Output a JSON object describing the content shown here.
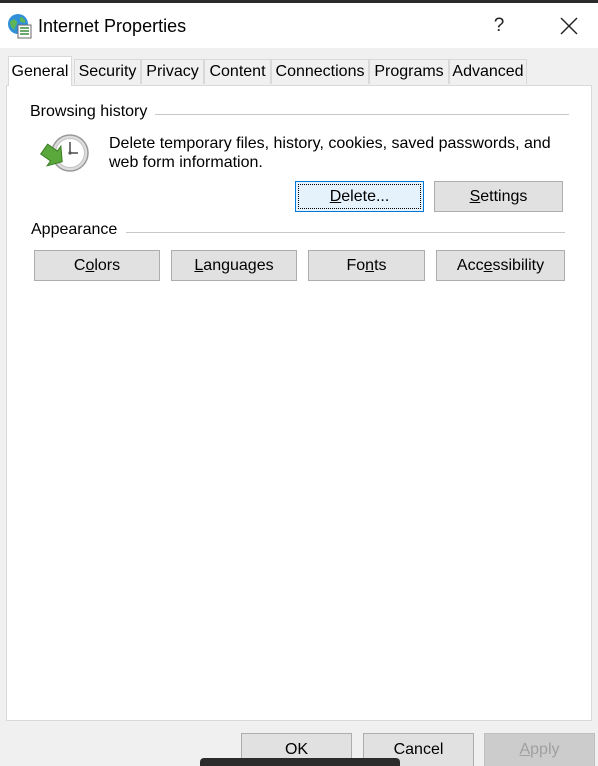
{
  "window": {
    "title": "Internet Properties",
    "app_icon": "internet-options-globe-icon",
    "help_label": "?",
    "close_icon": "close-icon"
  },
  "tabs": [
    {
      "label": "General",
      "active": true
    },
    {
      "label": "Security"
    },
    {
      "label": "Privacy"
    },
    {
      "label": "Content"
    },
    {
      "label": "Connections"
    },
    {
      "label": "Programs"
    },
    {
      "label": "Advanced"
    }
  ],
  "browsing_history": {
    "heading": "Browsing history",
    "icon": "clock-delete-icon",
    "description": "Delete temporary files, history, cookies, saved passwords, and web form information.",
    "delete_btn": {
      "before": "",
      "mnemonic": "D",
      "after": "elete..."
    },
    "settings_btn": {
      "before": "",
      "mnemonic": "S",
      "after": "ettings"
    }
  },
  "appearance": {
    "heading": "Appearance",
    "colors_btn": {
      "before": "C",
      "mnemonic": "o",
      "after": "lors"
    },
    "languages_btn": {
      "before": "",
      "mnemonic": "L",
      "after": "anguages"
    },
    "fonts_btn": {
      "before": "Fo",
      "mnemonic": "n",
      "after": "ts"
    },
    "accessibility_btn": {
      "before": "Acc",
      "mnemonic": "e",
      "after": "ssibility"
    }
  },
  "footer": {
    "ok_label": "OK",
    "cancel_label": "Cancel",
    "apply_btn": {
      "before": "",
      "mnemonic": "A",
      "after": "pply"
    }
  },
  "colors": {
    "accent": "#0078d7",
    "focus_fill": "#e5f1fb",
    "button_fill": "#e1e1e1"
  }
}
